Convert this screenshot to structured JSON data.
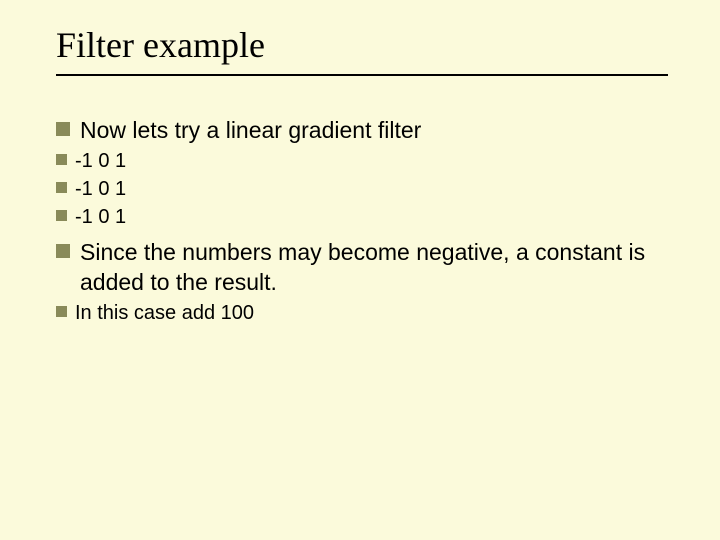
{
  "title": "Filter example",
  "bullets": {
    "b1": "Now lets try a linear gradient filter",
    "b1_1": "-1 0 1",
    "b1_2": "-1 0 1",
    "b1_3": "-1 0 1",
    "b2": "Since the numbers may become negative, a constant is added to the result.",
    "b2_1": "In this case add 100"
  }
}
